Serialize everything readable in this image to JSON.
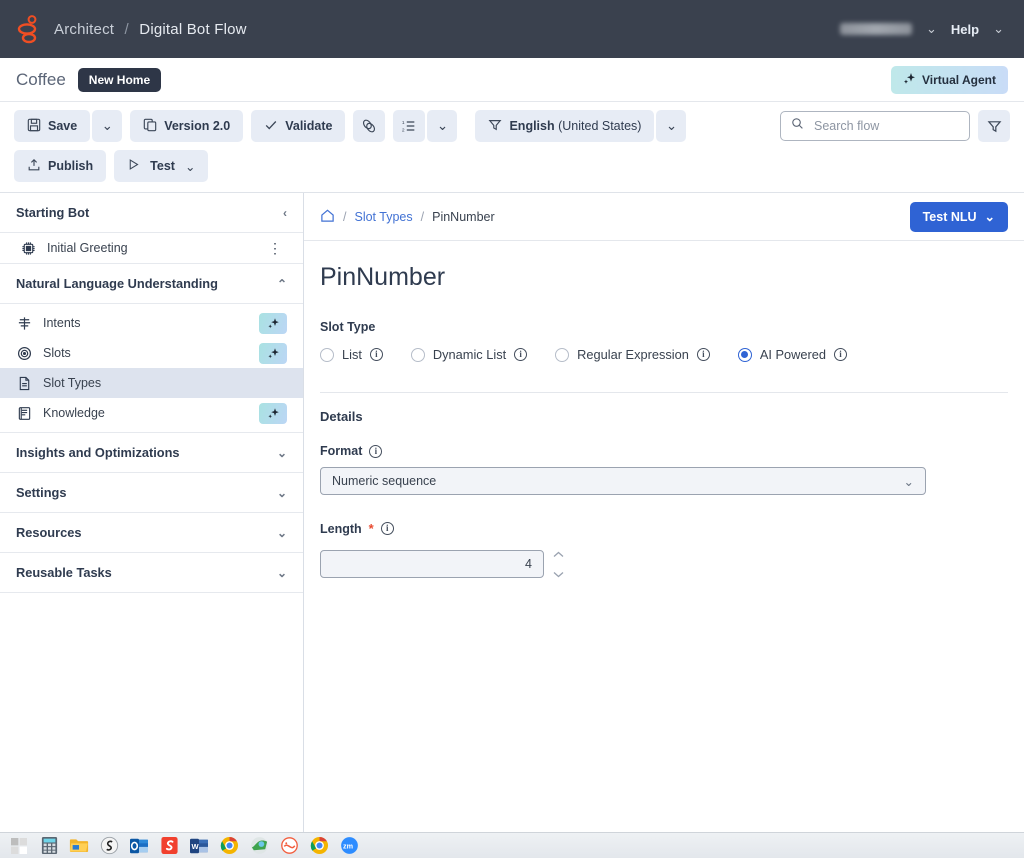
{
  "header": {
    "logo_icon": "genesys-logo-icon",
    "app_name": "Architect",
    "separator": "/",
    "section": "Digital Bot Flow",
    "user_name": "",
    "user_caret": "⌄",
    "help_label": "Help",
    "help_caret": "⌄"
  },
  "flow_bar": {
    "flow_name": "Coffee",
    "badge": "New Home",
    "virtual_agent": "Virtual Agent",
    "virtual_agent_icon": "sparkle-icon"
  },
  "toolbar": {
    "save_label": "Save",
    "save_icon": "floppy-disk-icon",
    "save_caret": "⌄",
    "version_label": "Version 2.0",
    "version_icon": "copy-icon",
    "validate_label": "Validate",
    "validate_icon": "check-icon",
    "link_icon": "link-chain-icon",
    "list_icon": "numbered-list-icon",
    "list_caret": "⌄",
    "language_label_strong": "English",
    "language_label_rest": " (United States)",
    "language_icon": "filter-funnel-icon",
    "language_caret": "⌄",
    "publish_label": "Publish",
    "publish_icon": "upload-icon",
    "test_label": "Test",
    "test_icon": "play-triangle-icon",
    "test_caret": "⌄",
    "search_placeholder": "Search flow",
    "search_value": "",
    "search_icon": "search-icon",
    "filter_icon": "filter-funnel-icon"
  },
  "sidebar": {
    "groups": [
      {
        "label": "Starting Bot",
        "chevron": "‹",
        "chevron_name": "chevron-left-icon"
      },
      {
        "label": "Natural Language Understanding",
        "chevron": "⌃",
        "chevron_name": "chevron-up-icon"
      },
      {
        "label": "Insights and Optimizations",
        "chevron": "⌄",
        "chevron_name": "chevron-down-icon"
      },
      {
        "label": "Settings",
        "chevron": "⌄",
        "chevron_name": "chevron-down-icon"
      },
      {
        "label": "Resources",
        "chevron": "⌄",
        "chevron_name": "chevron-down-icon"
      },
      {
        "label": "Reusable Tasks",
        "chevron": "⌄",
        "chevron_name": "chevron-down-icon"
      }
    ],
    "starting_bot_items": [
      {
        "label": "Initial Greeting",
        "icon": "bot-chip-icon",
        "trailing": "kebab-menu-icon"
      }
    ],
    "nlu_items": [
      {
        "label": "Intents",
        "icon": "intents-icon",
        "ai_badge": true,
        "selected": false
      },
      {
        "label": "Slots",
        "icon": "target-icon",
        "ai_badge": true,
        "selected": false
      },
      {
        "label": "Slot Types",
        "icon": "document-icon",
        "ai_badge": false,
        "selected": true
      },
      {
        "label": "Knowledge",
        "icon": "book-icon",
        "ai_badge": true,
        "selected": false
      }
    ]
  },
  "breadcrumb": {
    "home_icon": "home-icon",
    "items": [
      "Slot Types",
      "PinNumber"
    ],
    "separator": "/"
  },
  "test_nlu": {
    "label": "Test NLU",
    "caret": "⌄"
  },
  "main": {
    "page_title": "PinNumber",
    "slot_type_label": "Slot Type",
    "slot_type_options": [
      {
        "label": "List",
        "checked": false
      },
      {
        "label": "Dynamic List",
        "checked": false
      },
      {
        "label": "Regular Expression",
        "checked": false
      },
      {
        "label": "AI Powered",
        "checked": true
      }
    ],
    "details_label": "Details",
    "format_label": "Format",
    "format_value": "Numeric sequence",
    "format_caret": "⌄",
    "length_label": "Length",
    "length_required_mark": "*",
    "length_value": "4",
    "info_glyph": "i"
  },
  "taskbar": {
    "items": [
      {
        "name": "windows-start-icon"
      },
      {
        "name": "calculator-icon"
      },
      {
        "name": "file-explorer-icon"
      },
      {
        "name": "snagit-icon"
      },
      {
        "name": "outlook-icon"
      },
      {
        "name": "snagit-editor-icon"
      },
      {
        "name": "word-icon"
      },
      {
        "name": "chrome-icon"
      },
      {
        "name": "genesys-cloud-icon"
      },
      {
        "name": "udemy-icon"
      },
      {
        "name": "chrome-window-icon"
      },
      {
        "name": "zoom-icon"
      }
    ]
  },
  "colors": {
    "header_bg": "#3a414e",
    "accent_orange": "#f04e23",
    "primary_blue": "#2f63d4",
    "link_blue": "#4272d4",
    "toolbar_btn": "#e7ecf5",
    "sidebar_selected": "#dde3ee",
    "required_red": "#e8492e"
  }
}
